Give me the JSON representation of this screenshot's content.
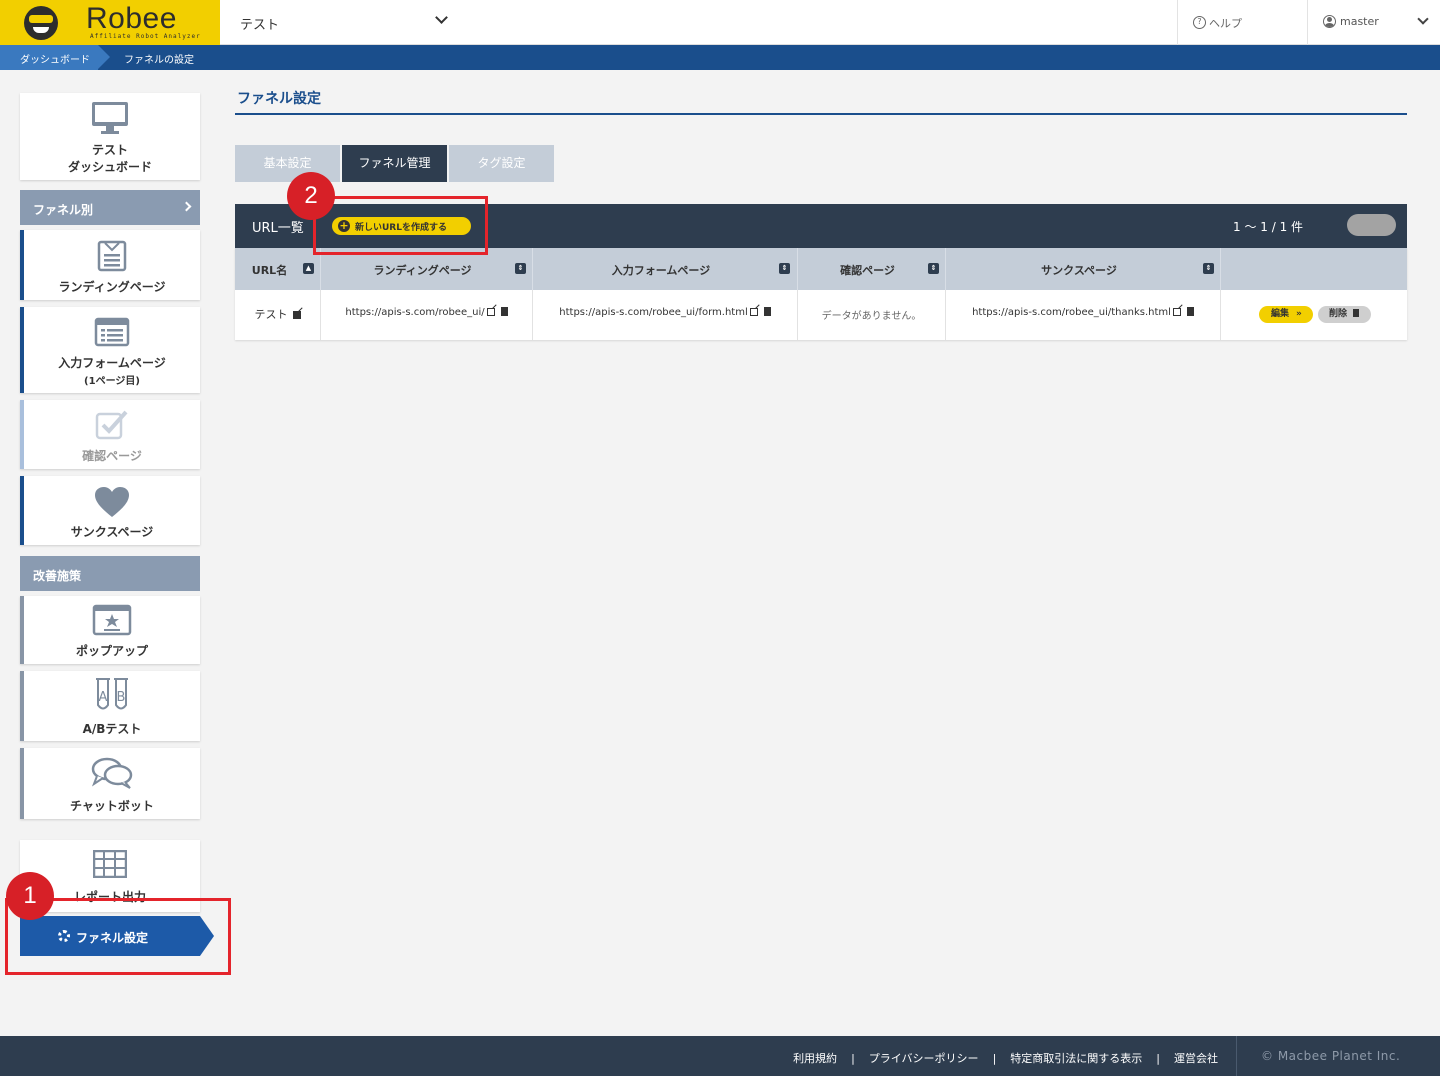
{
  "header": {
    "logo_text": "Robee",
    "logo_sub": "Affiliate Robot Analyzer",
    "site_selected": "テスト",
    "help_label": "ヘルプ",
    "user_label": "master"
  },
  "breadcrumb": {
    "item1": "ダッシュボード",
    "item2": "ファネルの設定"
  },
  "sidebar": {
    "dashboard_line1": "テスト",
    "dashboard_line2": "ダッシュボード",
    "section_funnel": "ファネル別",
    "landing": "ランディングページ",
    "form_line1": "入力フォームページ",
    "form_line2": "(1ページ目)",
    "confirm": "確認ページ",
    "thanks": "サンクスページ",
    "section_improve": "改善施策",
    "popup": "ポップアップ",
    "abtest": "A/Bテスト",
    "chatbot": "チャットボット",
    "report": "レポート出力",
    "funnel_setting": "ファネル設定"
  },
  "main": {
    "title": "ファネル設定",
    "tabs": [
      "基本設定",
      "ファネル管理",
      "タグ設定"
    ],
    "panel_title": "URL一覧",
    "new_url_button": "新しいURLを作成する",
    "count": "1 〜 1 / 1 件",
    "columns": [
      "URL名",
      "ランディングページ",
      "入力フォームページ",
      "確認ページ",
      "サンクスページ"
    ],
    "row": {
      "name": "テスト",
      "landing": "https://apis-s.com/robee_ui/",
      "form": "https://apis-s.com/robee_ui/form.html",
      "confirm": "データがありません。",
      "thanks": "https://apis-s.com/robee_ui/thanks.html",
      "edit": "編集",
      "delete": "削除"
    }
  },
  "annotations": {
    "n1": "1",
    "n2": "2"
  },
  "footer": {
    "link1": "利用規約",
    "link2": "プライバシーポリシー",
    "link3": "特定商取引法に関する表示",
    "link4": "運営会社",
    "separator": "|",
    "copyright": "© Macbee Planet Inc."
  },
  "colors": {
    "brand_yellow": "#f2cf00",
    "navy": "#1a4e8c",
    "dark": "#2e3d4f",
    "annotation_red": "#e4242b"
  }
}
